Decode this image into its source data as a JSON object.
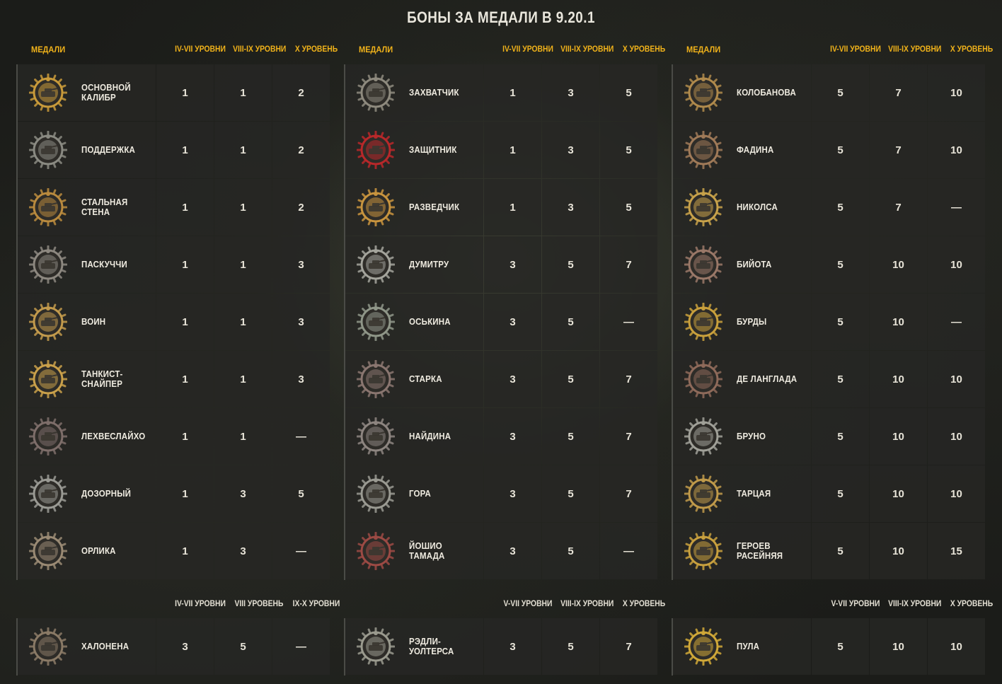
{
  "title": "БОНЫ ЗА МЕДАЛИ В 9.20.1",
  "columns": [
    {
      "headers": {
        "medals": "МЕДАЛИ",
        "c1": "IV-VII УРОВНИ",
        "c2": "VIII-IX УРОВНИ",
        "c3": "X УРОВЕНЬ"
      },
      "rows": [
        {
          "name": "ОСНОВНОЙ\nКАЛИБР",
          "v1": "1",
          "v2": "1",
          "v3": "2",
          "color": "#c89a3a"
        },
        {
          "name": "ПОДДЕРЖКА",
          "v1": "1",
          "v2": "1",
          "v3": "2",
          "color": "#8a8a82"
        },
        {
          "name": "СТАЛЬНАЯ\nСТЕНА",
          "v1": "1",
          "v2": "1",
          "v3": "2",
          "color": "#b98a3e"
        },
        {
          "name": "ПАСКУЧЧИ",
          "v1": "1",
          "v2": "1",
          "v3": "3",
          "color": "#8d8880"
        },
        {
          "name": "ВОИН",
          "v1": "1",
          "v2": "1",
          "v3": "3",
          "color": "#c29a4c"
        },
        {
          "name": "ТАНКИСТ-\nСНАЙПЕР",
          "v1": "1",
          "v2": "1",
          "v3": "3",
          "color": "#c9a04a"
        },
        {
          "name": "ЛЕХВЕСЛАЙХО",
          "v1": "1",
          "v2": "1",
          "v3": "—",
          "color": "#7e6e6a"
        },
        {
          "name": "ДОЗОРНЫЙ",
          "v1": "1",
          "v2": "3",
          "v3": "5",
          "color": "#9a9a94"
        },
        {
          "name": "ОРЛИКА",
          "v1": "1",
          "v2": "3",
          "v3": "—",
          "color": "#9a8a74"
        }
      ],
      "extra_headers": {
        "c1": "IV-VII УРОВНИ",
        "c2": "VIII УРОВЕНЬ",
        "c3": "IX-X УРОВНИ"
      },
      "extra_row": {
        "name": "ХАЛОНЕНА",
        "v1": "3",
        "v2": "5",
        "v3": "—",
        "color": "#8a7a66"
      }
    },
    {
      "headers": {
        "medals": "МЕДАЛИ",
        "c1": "IV-VII УРОВНИ",
        "c2": "VIII-IX УРОВНИ",
        "c3": "X УРОВЕНЬ"
      },
      "rows": [
        {
          "name": "ЗАХВАТЧИК",
          "v1": "1",
          "v2": "3",
          "v3": "5",
          "color": "#8e8a7e"
        },
        {
          "name": "ЗАЩИТНИК",
          "v1": "1",
          "v2": "3",
          "v3": "5",
          "color": "#b8282a"
        },
        {
          "name": "РАЗВЕДЧИК",
          "v1": "1",
          "v2": "3",
          "v3": "5",
          "color": "#c8943e"
        },
        {
          "name": "ДУМИТРУ",
          "v1": "3",
          "v2": "5",
          "v3": "7",
          "color": "#a4a49c"
        },
        {
          "name": "ОСЬКИНА",
          "v1": "3",
          "v2": "5",
          "v3": "—",
          "color": "#8f9688"
        },
        {
          "name": "СТАРКА",
          "v1": "3",
          "v2": "5",
          "v3": "7",
          "color": "#8a7670"
        },
        {
          "name": "НАЙДИНА",
          "v1": "3",
          "v2": "5",
          "v3": "7",
          "color": "#8d8580"
        },
        {
          "name": "ГОРА",
          "v1": "3",
          "v2": "5",
          "v3": "7",
          "color": "#9a9a92"
        },
        {
          "name": "ЙОШИО\nТАМАДА",
          "v1": "3",
          "v2": "5",
          "v3": "—",
          "color": "#9c4a44"
        }
      ],
      "extra_headers": {
        "c1": "V-VII УРОВНИ",
        "c2": "VIII-IX УРОВНИ",
        "c3": "X УРОВЕНЬ"
      },
      "extra_row": {
        "name": "РЭДЛИ-\nУОЛТЕРСА",
        "v1": "3",
        "v2": "5",
        "v3": "7",
        "color": "#9a9a8e"
      }
    },
    {
      "headers": {
        "medals": "МЕДАЛИ",
        "c1": "IV-VII УРОВНИ",
        "c2": "VIII-IX УРОВНИ",
        "c3": "X УРОВЕНЬ"
      },
      "rows": [
        {
          "name": "КОЛОБАНОВА",
          "v1": "5",
          "v2": "7",
          "v3": "10",
          "color": "#b08a4c"
        },
        {
          "name": "ФАДИНА",
          "v1": "5",
          "v2": "7",
          "v3": "10",
          "color": "#a07a58"
        },
        {
          "name": "НИКОЛСА",
          "v1": "5",
          "v2": "7",
          "v3": "—",
          "color": "#c8a24a"
        },
        {
          "name": "БИЙОТА",
          "v1": "5",
          "v2": "10",
          "v3": "10",
          "color": "#9a7868"
        },
        {
          "name": "БУРДЫ",
          "v1": "5",
          "v2": "10",
          "v3": "—",
          "color": "#c9a03c"
        },
        {
          "name": "ДЕ ЛАНГЛАДА",
          "v1": "5",
          "v2": "10",
          "v3": "10",
          "color": "#8e6a5a"
        },
        {
          "name": "БРУНО",
          "v1": "5",
          "v2": "10",
          "v3": "10",
          "color": "#a0a098"
        },
        {
          "name": "ТАРЦАЯ",
          "v1": "5",
          "v2": "10",
          "v3": "10",
          "color": "#c09a4a"
        },
        {
          "name": "ГЕРОЕВ\nРАСЕЙНЯЯ",
          "v1": "5",
          "v2": "10",
          "v3": "15",
          "color": "#c8a03e"
        }
      ],
      "extra_headers": {
        "c1": "V-VII УРОВНИ",
        "c2": "VIII-IX УРОВНИ",
        "c3": "X УРОВЕНЬ"
      },
      "extra_row": {
        "name": "ПУЛА",
        "v1": "5",
        "v2": "10",
        "v3": "10",
        "color": "#d0a838"
      }
    }
  ]
}
